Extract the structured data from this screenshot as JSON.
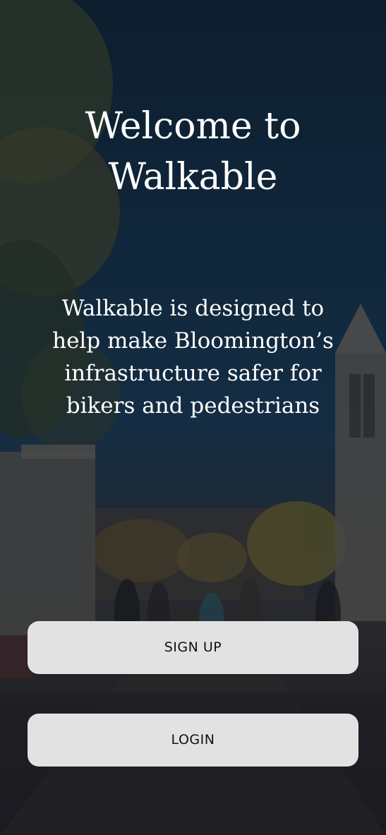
{
  "welcome": {
    "title_lines": [
      "Welcome to",
      "Walkable"
    ]
  },
  "description": {
    "lines": [
      "Walkable is designed to",
      "help make Bloomington’s",
      "infrastructure safer for",
      "bikers and pedestrians"
    ]
  },
  "actions": {
    "signup_label": "SIGN UP",
    "login_label": "LOGIN"
  },
  "colors": {
    "button_background": "#e2e2e2",
    "button_text": "#111111",
    "heading_text": "#ffffff",
    "sky_tint": "#16324a"
  }
}
